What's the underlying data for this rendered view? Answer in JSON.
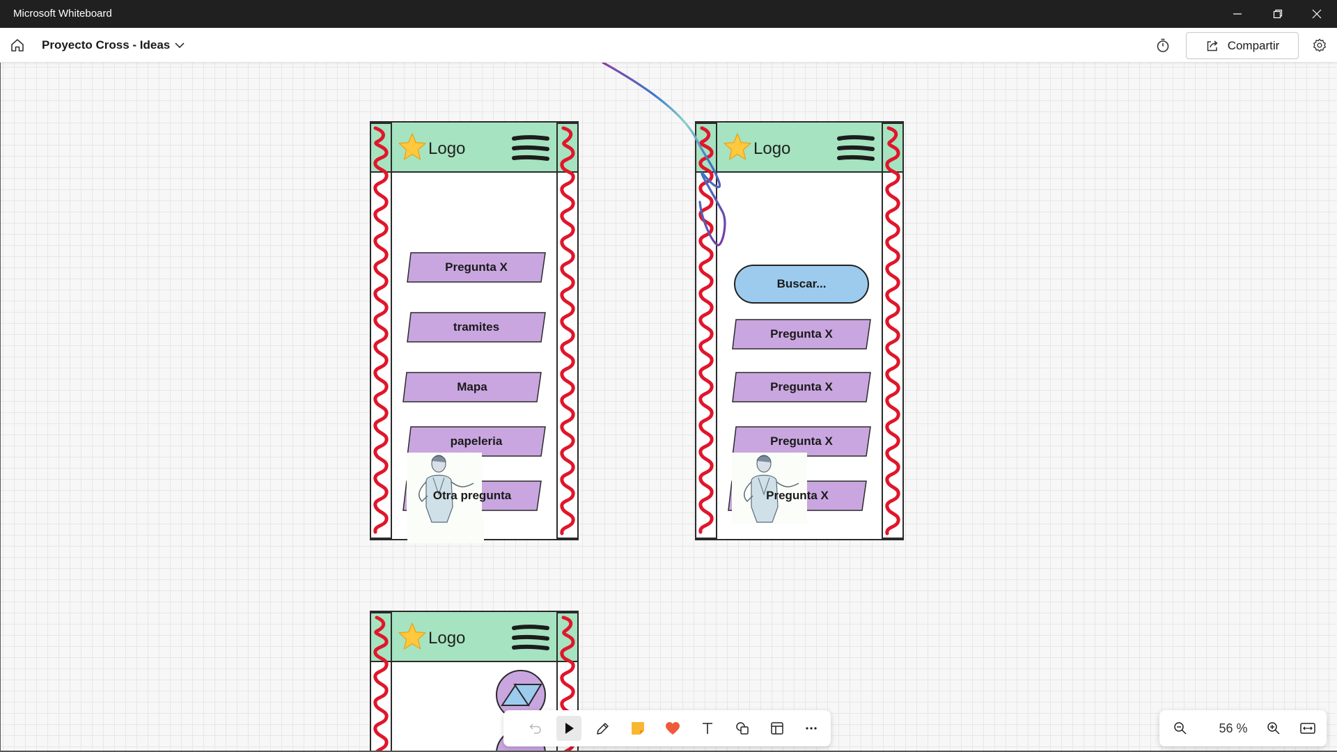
{
  "window": {
    "title": "Microsoft Whiteboard"
  },
  "header": {
    "board_title": "Proyecto Cross - Ideas",
    "share_label": "Compartir"
  },
  "phones": {
    "phone1": {
      "logo": "Logo",
      "items": [
        "Pregunta X",
        "tramites",
        "Mapa",
        "papeleria",
        "Otra pregunta"
      ]
    },
    "phone2": {
      "logo": "Logo",
      "search": "Buscar...",
      "items": [
        "Pregunta X",
        "Pregunta X",
        "Pregunta X",
        "Pregunta X"
      ]
    },
    "phone3": {
      "logo": "Logo"
    }
  },
  "zoom": {
    "level": "56 %"
  },
  "colors": {
    "header_green": "#a6e3c0",
    "pill_purple": "#c9a6e0",
    "search_blue": "#9ccbee",
    "squiggle_red": "#e0162b",
    "heart_red": "#f05a3c",
    "note_yellow": "#f7b733"
  },
  "icons": {
    "toolbar": [
      "undo-icon",
      "select-arrow-icon",
      "pen-icon",
      "sticky-note-icon",
      "reaction-heart-icon",
      "text-icon",
      "shapes-icon",
      "templates-icon",
      "more-icon"
    ],
    "zoom": [
      "zoom-out-icon",
      "zoom-in-icon",
      "fit-to-screen-icon"
    ]
  }
}
